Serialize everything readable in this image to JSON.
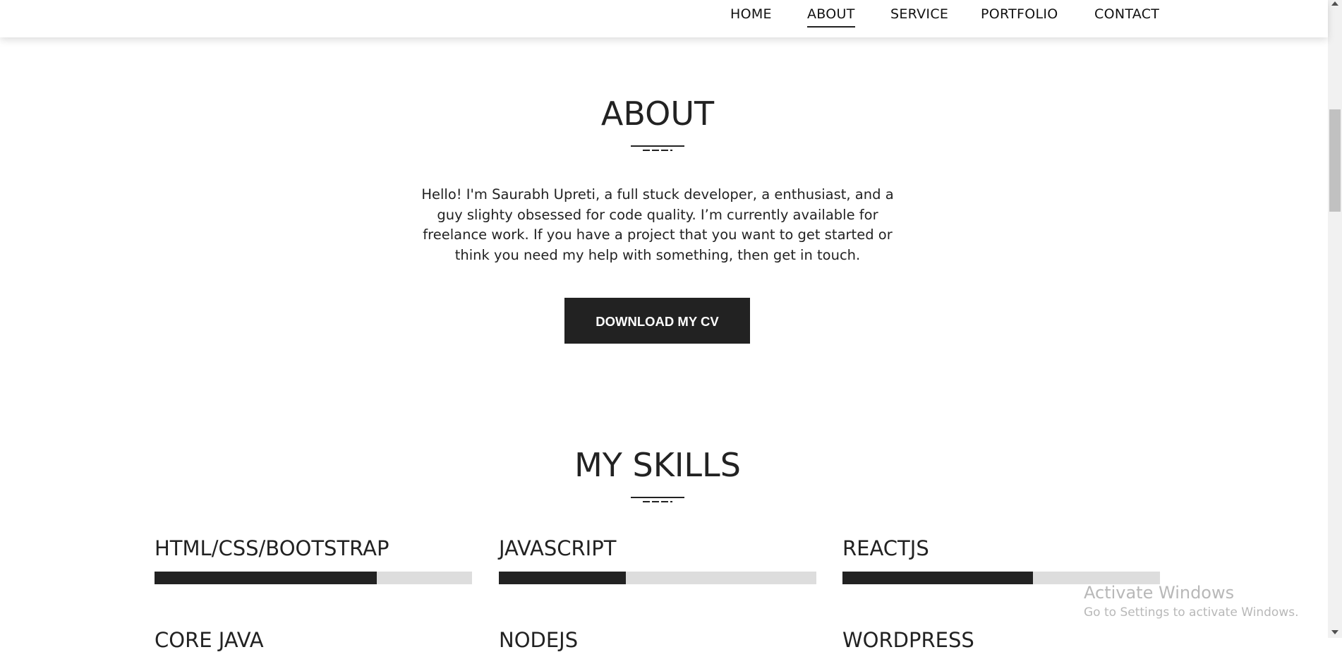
{
  "nav": {
    "items": [
      {
        "label": "HOME"
      },
      {
        "label": "ABOUT",
        "active": true
      },
      {
        "label": "SERVICE"
      },
      {
        "label": "PORTFOLIO"
      },
      {
        "label": "CONTACT"
      }
    ]
  },
  "about": {
    "title": "ABOUT",
    "text": "Hello! I'm Saurabh Upreti, a full stuck developer, a enthusiast, and a guy slighty obsessed for code quality. I’m currently available for freelance work. If you have a project that you want to get started or think you need my help with something, then get in touch.",
    "button_label": "DOWNLOAD MY CV"
  },
  "skills": {
    "title": "MY SKILLS",
    "items": [
      {
        "name": "HTML/CSS/BOOTSTRAP",
        "level": 0.7
      },
      {
        "name": "JAVASCRIPT",
        "level": 0.4
      },
      {
        "name": "REACTJS",
        "level": 0.6
      }
    ],
    "next_row": [
      "CORE JAVA",
      "NODEJS",
      "WORDPRESS"
    ]
  },
  "watermark": {
    "title": "Activate Windows",
    "subtitle": "Go to Settings to activate Windows."
  },
  "colors": {
    "accent": "#222222",
    "track": "#dddddd",
    "background": "#ffffff"
  }
}
